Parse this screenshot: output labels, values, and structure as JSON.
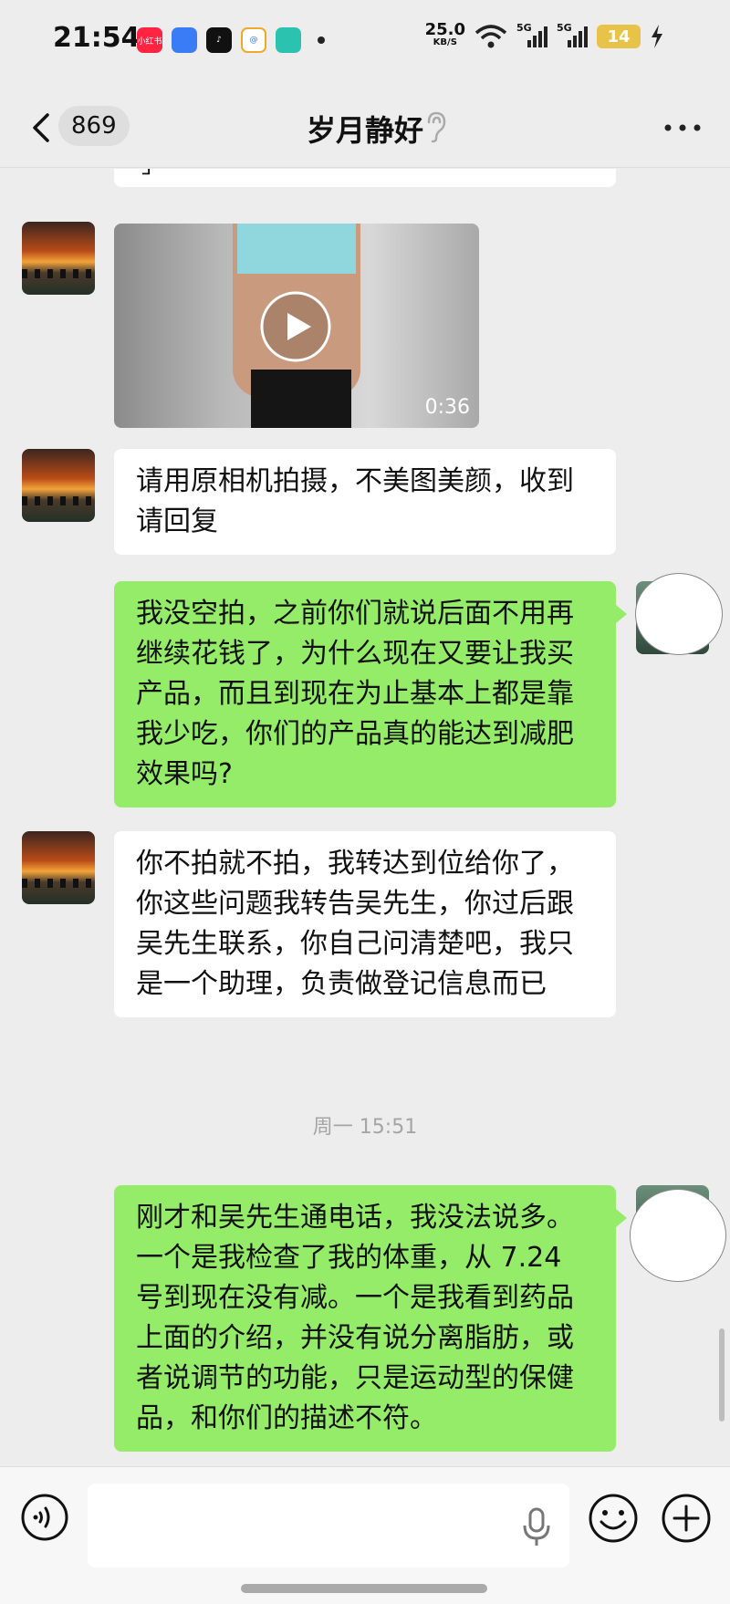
{
  "status_bar": {
    "time": "21:54",
    "app_icons": [
      {
        "name": "xiaohongshu",
        "label": "小红书",
        "color": "#ff2442"
      },
      {
        "name": "app-blue",
        "label": "",
        "color": "#3a7bf6"
      },
      {
        "name": "tiktok",
        "label": "",
        "color": "#111111"
      },
      {
        "name": "app-colorful",
        "label": "",
        "color": "#f0a92a"
      },
      {
        "name": "app-teal",
        "label": "",
        "color": "#2bc3b0"
      }
    ],
    "net_speed": "25.0",
    "net_unit": "KB/S",
    "signal_1": "5G",
    "signal_2": "5G",
    "battery": "14"
  },
  "nav": {
    "unread_count": "869",
    "title": "岁月静好"
  },
  "messages": [
    {
      "type": "text",
      "direction": "in",
      "text": "请用原相机拍摄，不美图美颜，收到请回复"
    },
    {
      "type": "text",
      "direction": "out",
      "text": "我没空拍，之前你们就说后面不用再继续花钱了，为什么现在又要让我买产品，而且到现在为止基本上都是靠我少吃，你们的产品真的能达到减肥效果吗?"
    },
    {
      "type": "text",
      "direction": "in",
      "text": "你不拍就不拍，我转达到位给你了，你这些问题我转告吴先生，你过后跟吴先生联系，你自己问清楚吧，我只是一个助理，负责做登记信息而已"
    },
    {
      "type": "text",
      "direction": "out",
      "text": "刚才和吴先生通电话，我没法说多。一个是我检查了我的体重，从 7.24 号到现在没有减。一个是我看到药品上面的介绍，并没有说分离脂肪，或者说调节的功能，只是运动型的保健品，和你们的描述不符。"
    }
  ],
  "video": {
    "duration": "0:36"
  },
  "timestamp": "周一 15:51",
  "input": {
    "value": ""
  },
  "colors": {
    "outgoing_bubble": "#95ec69",
    "incoming_bubble": "#ffffff",
    "background": "#ededed"
  }
}
